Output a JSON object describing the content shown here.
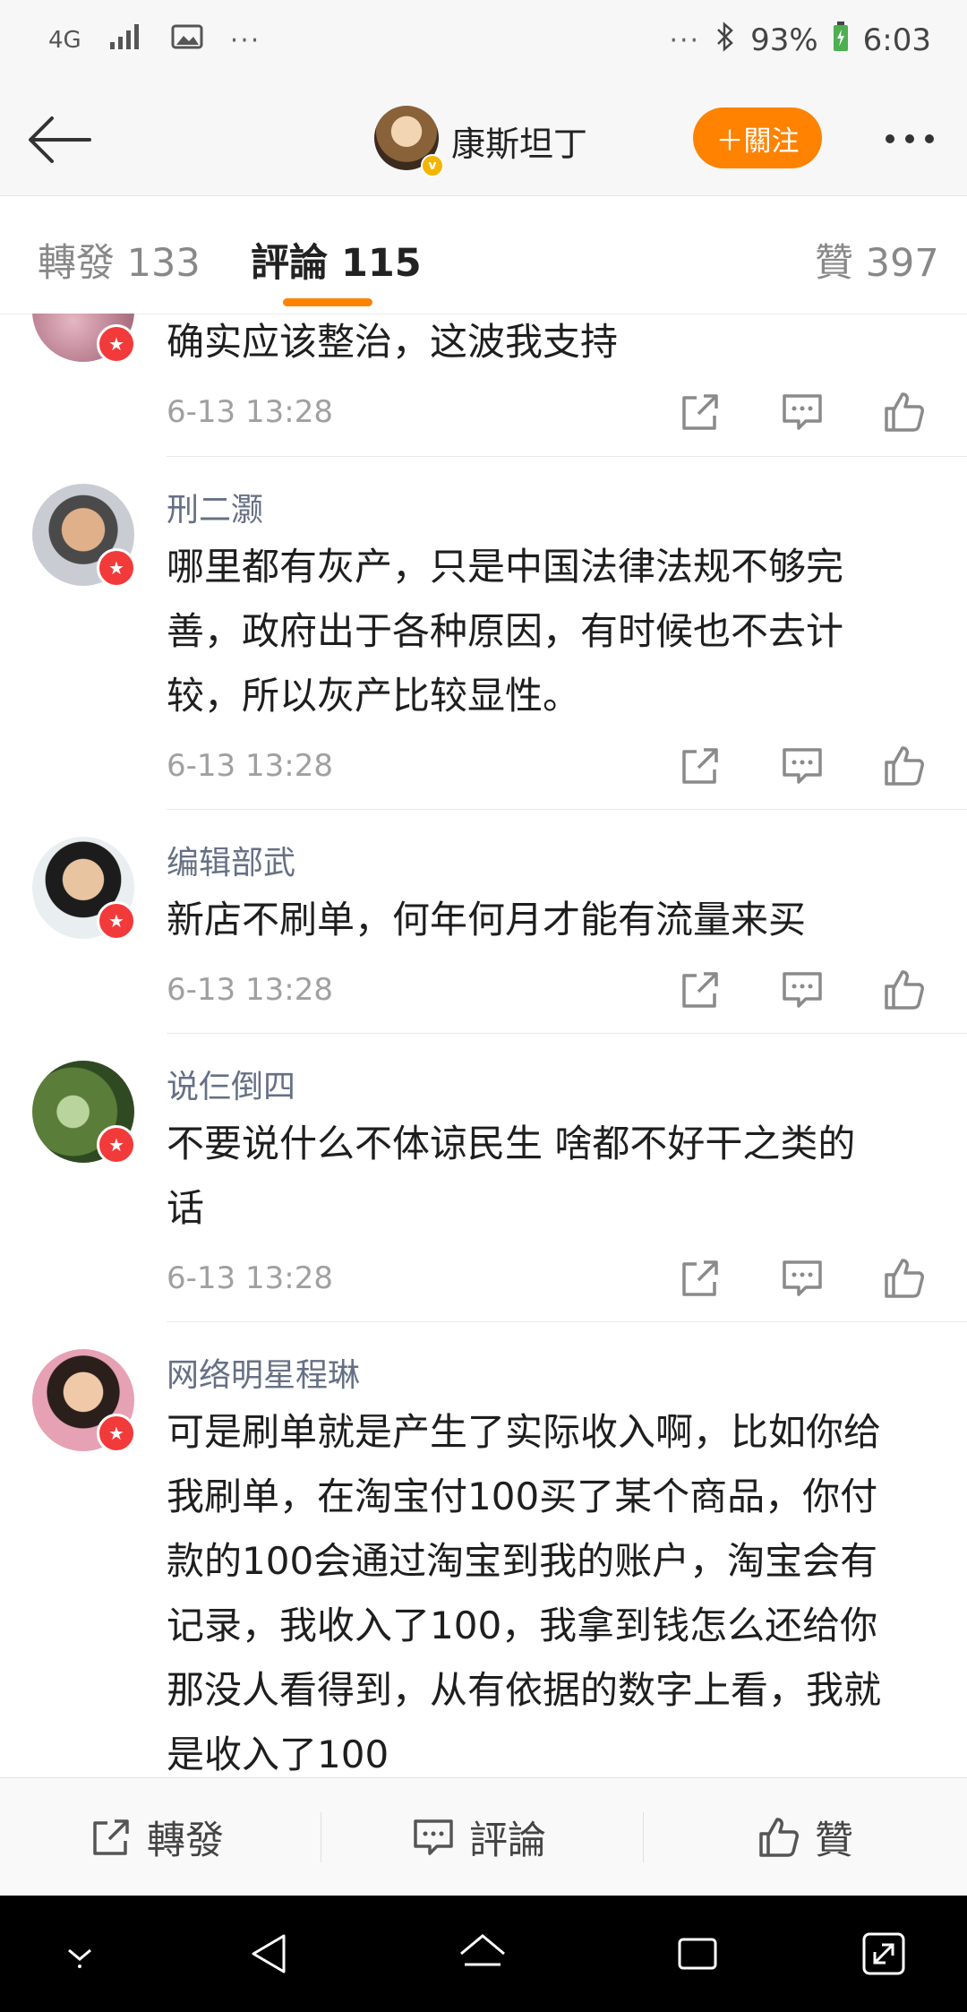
{
  "status_bar": {
    "network": "4G",
    "dots_left": "···",
    "dots_right": "···",
    "battery": "93%",
    "time": "6:03"
  },
  "header": {
    "user_name": "康斯坦丁",
    "follow_label": "＋關注",
    "verified_badge": "v"
  },
  "tabs": {
    "repost": "轉發 133",
    "comment": "評論 115",
    "like": "贊 397"
  },
  "comments": [
    {
      "name": "",
      "text_lines": [
        "确实应该整治，这波我支持"
      ],
      "time": "6-13 13:28"
    },
    {
      "name": "刑二灏",
      "text_lines": [
        "哪里都有灰产，只是中国法律法规不够完",
        "善，政府出于各种原因，有时候也不去计",
        "较，所以灰产比较显性。"
      ],
      "time": "6-13 13:28"
    },
    {
      "name": "编辑部武",
      "text_lines": [
        "新店不刷单，何年何月才能有流量来买"
      ],
      "time": "6-13 13:28"
    },
    {
      "name": "说仨倒四",
      "text_lines": [
        "不要说什么不体谅民生 啥都不好干之类的",
        "话"
      ],
      "time": "6-13 13:28"
    },
    {
      "name": "网络明星程琳",
      "text_lines": [
        "可是刷单就是产生了实际收入啊，比如你给",
        "我刷单，在淘宝付100买了某个商品，你付",
        "款的100会通过淘宝到我的账户，淘宝会有",
        "记录，我收入了100，我拿到钱怎么还给你",
        "那没人看得到，从有依据的数字上看，我就",
        "是收入了100"
      ],
      "time": ""
    }
  ],
  "comment_badge": "★",
  "bottom_bar": {
    "repost": "轉發",
    "comment": "評論",
    "like": "贊"
  },
  "colors": {
    "accent": "#ff8200",
    "badge_red": "#f23a3a",
    "name_gray": "#667085"
  }
}
